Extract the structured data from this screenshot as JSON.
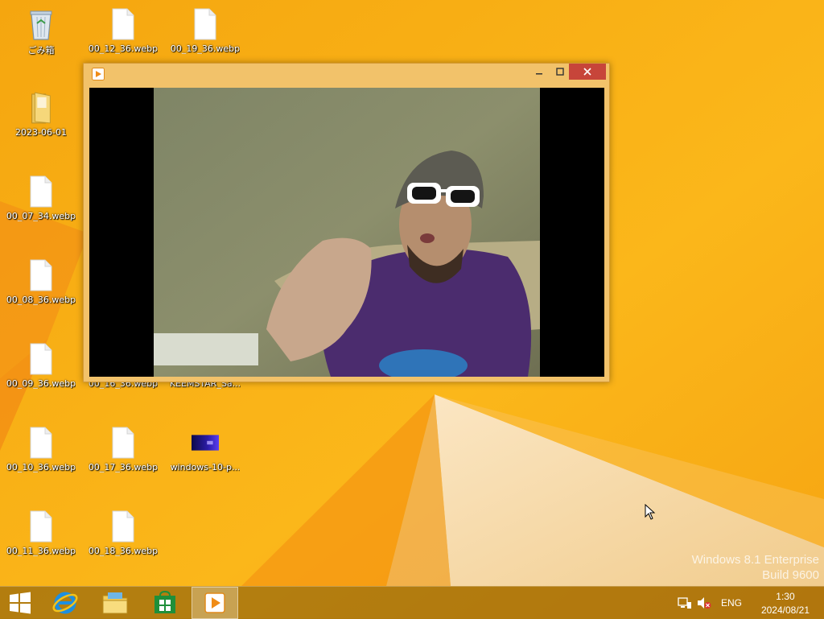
{
  "desktop": {
    "icons": [
      {
        "label": "ごみ箱",
        "type": "recycle-bin"
      },
      {
        "label": "00_12_36.webp",
        "type": "file"
      },
      {
        "label": "00_19_36.webp",
        "type": "file"
      },
      {
        "label": "2023-06-01",
        "type": "folder"
      },
      {
        "label": "00_07_34.webp",
        "type": "file"
      },
      {
        "label": "00_08_36.webp",
        "type": "file"
      },
      {
        "label": "00_09_36.webp",
        "type": "file"
      },
      {
        "label": "00_16_36.webp",
        "type": "file"
      },
      {
        "label": "KEEMSTAR_Sa...",
        "type": "video"
      },
      {
        "label": "00_10_36.webp",
        "type": "file"
      },
      {
        "label": "00_17_36.webp",
        "type": "file"
      },
      {
        "label": "windows-10-p...",
        "type": "image"
      },
      {
        "label": "00_11_36.webp",
        "type": "file"
      },
      {
        "label": "00_18_36.webp",
        "type": "file"
      }
    ]
  },
  "window": {
    "app_icon": "media-player-icon",
    "buttons": {
      "minimize": "minimize-icon",
      "maximize": "maximize-icon",
      "close": "close-icon"
    }
  },
  "watermark": {
    "line1": "Windows 8.1 Enterprise",
    "line2": "Build 9600"
  },
  "taskbar": {
    "items": [
      "start-icon",
      "internet-explorer-icon",
      "file-explorer-icon",
      "store-icon",
      "media-player-icon"
    ],
    "tray": {
      "language": "ENG",
      "time": "1:30",
      "date": "2024/08/21"
    }
  },
  "colors": {
    "wallpaper": "#f7ad12",
    "window_frame": "#f2c26a",
    "close_button": "#c7453a"
  }
}
